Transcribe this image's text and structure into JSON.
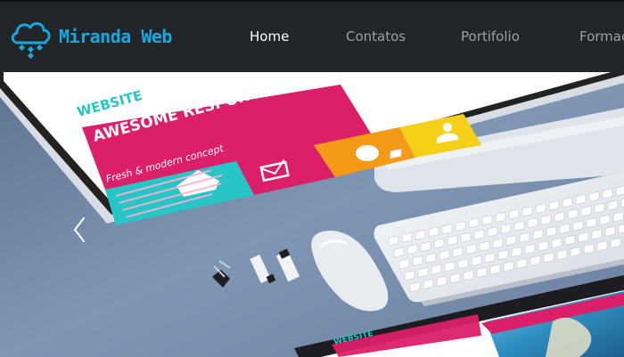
{
  "brand": {
    "name": "Miranda Web",
    "icon": "cloud-icon",
    "color": "#18a8e0"
  },
  "nav": {
    "items": [
      {
        "id": "home",
        "label": "Home",
        "active": true
      },
      {
        "id": "contatos",
        "label": "Contatos",
        "active": false
      },
      {
        "id": "portfolio",
        "label": "Portifolio",
        "active": false
      },
      {
        "id": "formacao",
        "label": "Formacao",
        "active": false
      }
    ]
  },
  "hero": {
    "slide_image": {
      "monitor_screen": {
        "tab": "WEBSITE",
        "headline": "AWESOME RESPONSIVE DESIGN",
        "tagline": "Fresh & modern concept"
      },
      "tablet_screen": {
        "tab": "WEBSITE"
      }
    },
    "controls": {
      "prev": "chevron-left-icon"
    }
  },
  "colors": {
    "navbar_bg": "#212529",
    "nav_active": "#ffffff",
    "nav_inactive": "#9aa0a6",
    "accent_magenta": "#dc1f69",
    "accent_cyan": "#27c5c7",
    "accent_orange": "#f49a17",
    "accent_yellow": "#f5d019"
  }
}
